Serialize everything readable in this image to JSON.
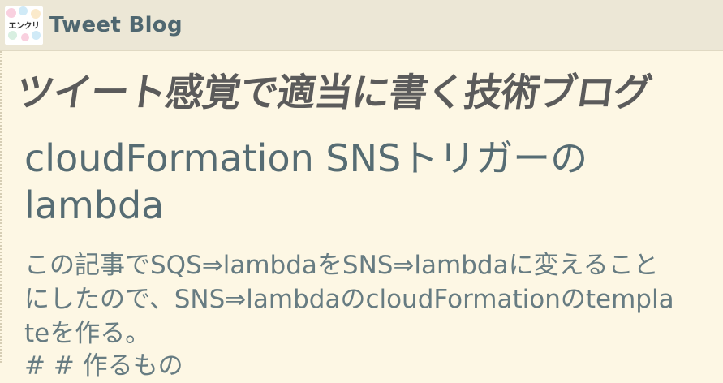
{
  "header": {
    "logo_text": "エンクリ",
    "site_title": "Tweet Blog"
  },
  "tagline": "ツイート感覚で適当に書く技術ブログ",
  "post": {
    "title": "cloudFormation SNSトリガーのlambda",
    "body": "この記事でSQS⇒lambdaをSNS⇒lambdaに変えることにしたので、SNS⇒lambdaのcloudFormationのtemplateを作る。",
    "subhead": "# # 作るもの"
  },
  "colors": {
    "page_background": "#fdf7e4",
    "header_background": "#ece7d6",
    "site_title": "#4f6770",
    "tagline": "#5b5b5b",
    "post_title": "#566c73",
    "body_text": "#677c82"
  }
}
